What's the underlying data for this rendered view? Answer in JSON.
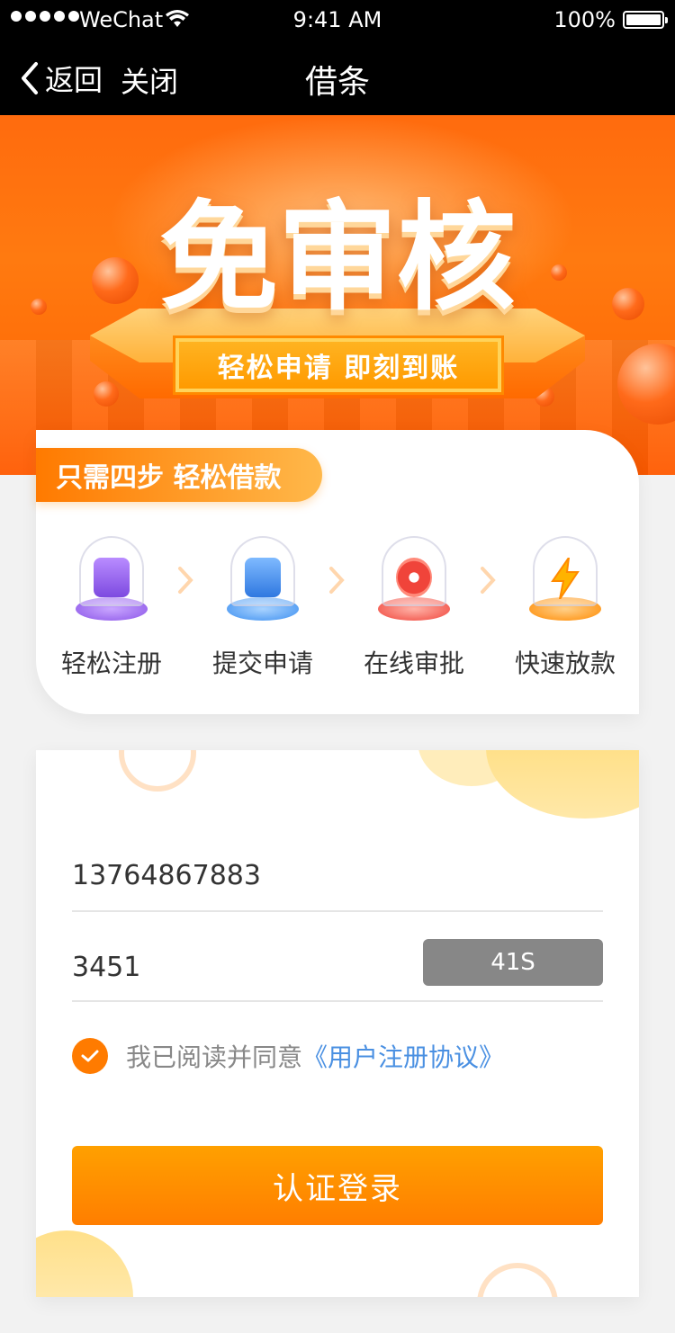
{
  "status_bar": {
    "carrier": "WeChat",
    "time": "9:41 AM",
    "battery": "100%"
  },
  "nav": {
    "back_label": "返回",
    "close_label": "关闭",
    "title": "借条"
  },
  "banner": {
    "headline": "免审核",
    "tagline": "轻松申请  即刻到账"
  },
  "steps": {
    "tag": "只需四步  轻松借款",
    "items": [
      {
        "label": "轻松注册",
        "icon": "register-icon",
        "color": "#9b6cf0"
      },
      {
        "label": "提交申请",
        "icon": "submit-application-icon",
        "color": "#3d8ff0"
      },
      {
        "label": "在线审批",
        "icon": "online-review-icon",
        "color": "#f0443a"
      },
      {
        "label": "快速放款",
        "icon": "fast-loan-icon",
        "color": "#ff9a00"
      }
    ]
  },
  "form": {
    "phone_value": "13764867883",
    "code_value": "3451",
    "code_button": "41S",
    "agree_text": "我已阅读并同意",
    "agreement_link": "《用户注册协议》",
    "submit_label": "认证登录"
  },
  "colors": {
    "accent": "#ff7b00",
    "link": "#4a90e2",
    "countdown_bg": "#878787"
  }
}
